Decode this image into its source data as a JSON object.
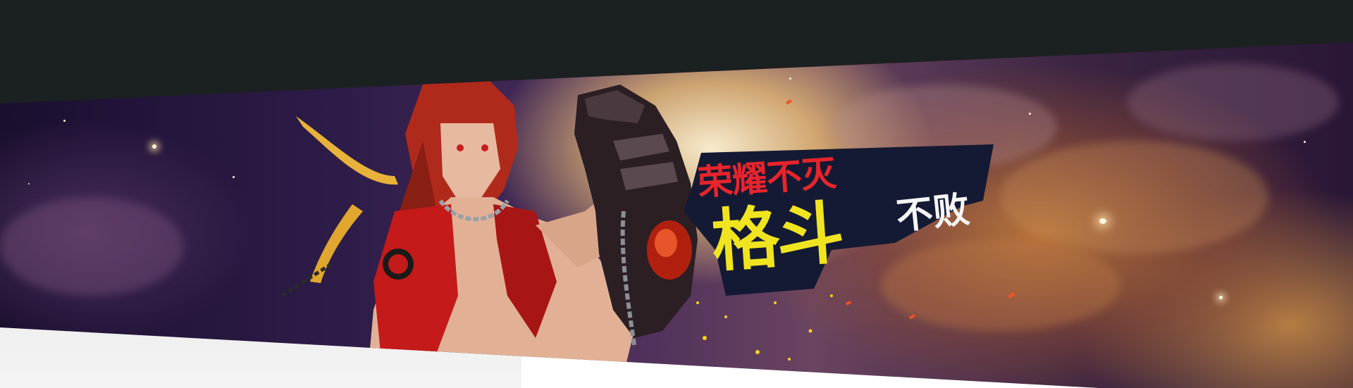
{
  "header": {
    "bar_color": "#1b2021"
  },
  "banner": {
    "slogan": {
      "line1_red": "荣耀",
      "line1_white": "不灭",
      "line2_yellow": "格斗",
      "line2_white": "不败"
    },
    "colors": {
      "slogan_red": "#e8242c",
      "slogan_yellow": "#f0e420",
      "slogan_white": "#f5f5f5",
      "slogan_panel": "#141a33"
    },
    "art": {
      "character": "red-haired-warrior-illustration",
      "gauntlet": "armored-gauntlet-icon"
    }
  }
}
